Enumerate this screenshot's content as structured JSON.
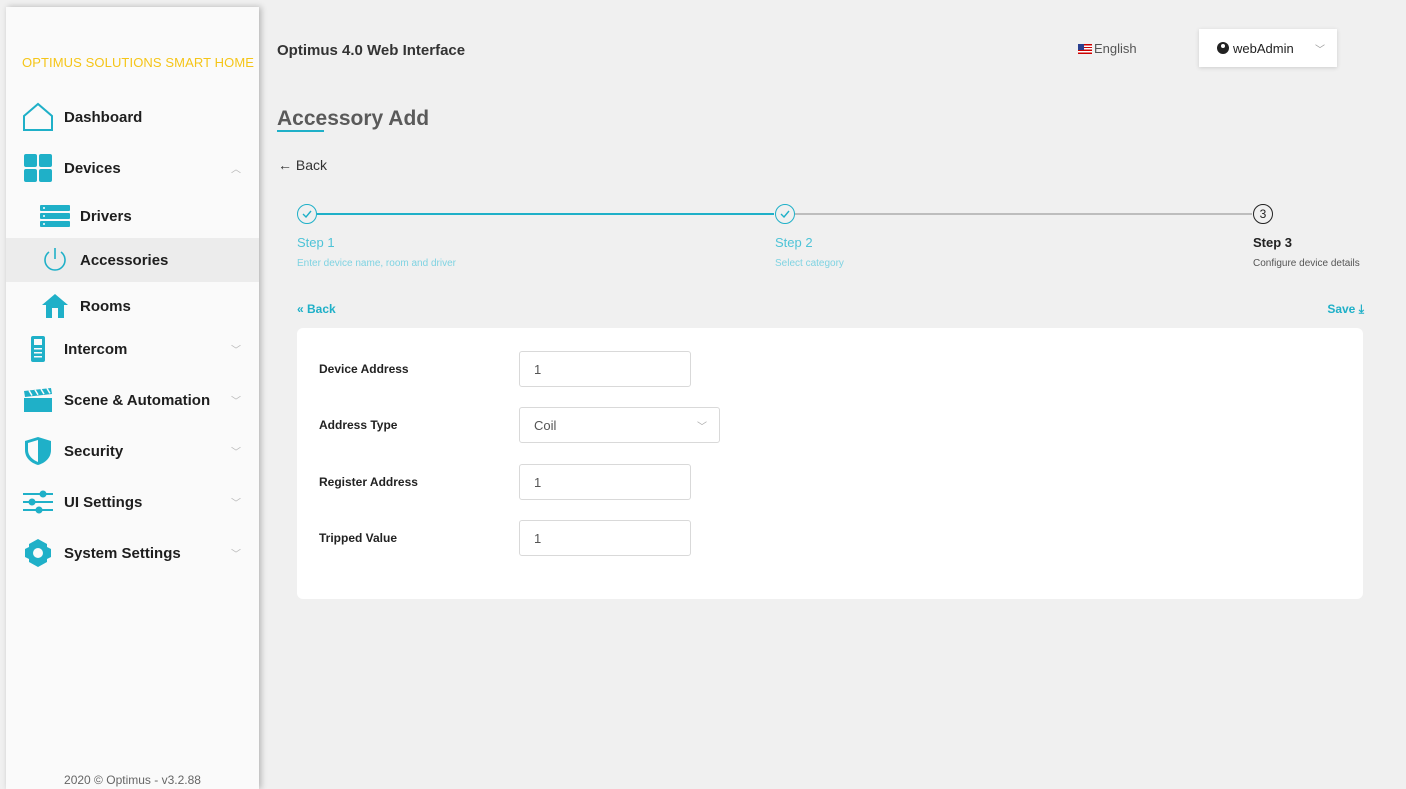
{
  "sidebar": {
    "brand": "OPTIMUS SOLUTIONS SMART HOME",
    "items": [
      {
        "label": "Dashboard"
      },
      {
        "label": "Devices"
      },
      {
        "label": "Drivers"
      },
      {
        "label": "Accessories"
      },
      {
        "label": "Rooms"
      },
      {
        "label": "Intercom"
      },
      {
        "label": "Scene & Automation"
      },
      {
        "label": "Security"
      },
      {
        "label": "UI Settings"
      },
      {
        "label": "System Settings"
      }
    ],
    "footer": "2020 © Optimus - v3.2.88"
  },
  "header": {
    "app_title": "Optimus 4.0 Web Interface",
    "language": "English",
    "user": "webAdmin"
  },
  "page": {
    "title": "Accessory Add",
    "back_label": "← Back"
  },
  "stepper": {
    "steps": [
      {
        "title": "Step 1",
        "desc": "Enter device name, room and driver",
        "status": "done"
      },
      {
        "title": "Step 2",
        "desc": "Select category",
        "status": "done"
      },
      {
        "title": "Step 3",
        "desc": "Configure device details",
        "status": "current",
        "number": "3"
      }
    ]
  },
  "form": {
    "back_label": "« Back",
    "save_label": "Save ⤓",
    "fields": [
      {
        "label": "Device Address",
        "value": "1"
      },
      {
        "label": "Address Type",
        "value": "Coil"
      },
      {
        "label": "Register Address",
        "value": "1"
      },
      {
        "label": "Tripped Value",
        "value": "1"
      }
    ]
  },
  "colors": {
    "accent": "#1fb0c8",
    "brand": "#f5c518"
  }
}
